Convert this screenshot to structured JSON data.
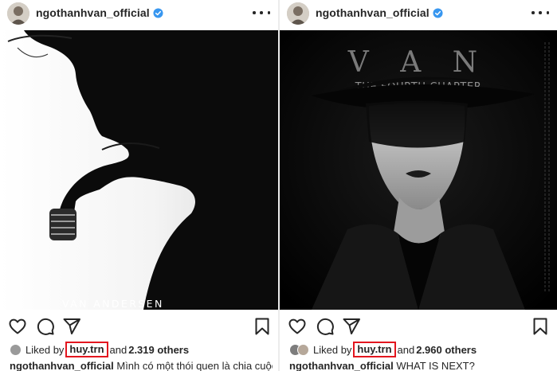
{
  "posts": [
    {
      "username": "ngothanhvan_official",
      "image_text": "VAN ANDERSEN",
      "likes": {
        "prefix": "Liked by",
        "highlighted_user": "huy.trn",
        "joiner": "and",
        "others": "2.319 others"
      },
      "caption": {
        "username": "ngothanhvan_official",
        "text": "Mình có một thói quen là chia cuộc"
      }
    },
    {
      "username": "ngothanhvan_official",
      "image_title": "V A N",
      "image_subtitle": "THE FOURTH CHAPTER",
      "likes": {
        "prefix": "Liked by",
        "highlighted_user": "huy.trn",
        "joiner": "and",
        "others": "2.960 others"
      },
      "caption": {
        "username": "ngothanhvan_official",
        "text": "WHAT IS NEXT?"
      }
    }
  ],
  "icons": [
    "heart-icon",
    "comment-icon",
    "share-icon",
    "bookmark-icon",
    "more-icon",
    "verified-icon"
  ],
  "colors": {
    "verified": "#3897f0",
    "highlight_box": "#e3161f",
    "text": "#262626"
  }
}
